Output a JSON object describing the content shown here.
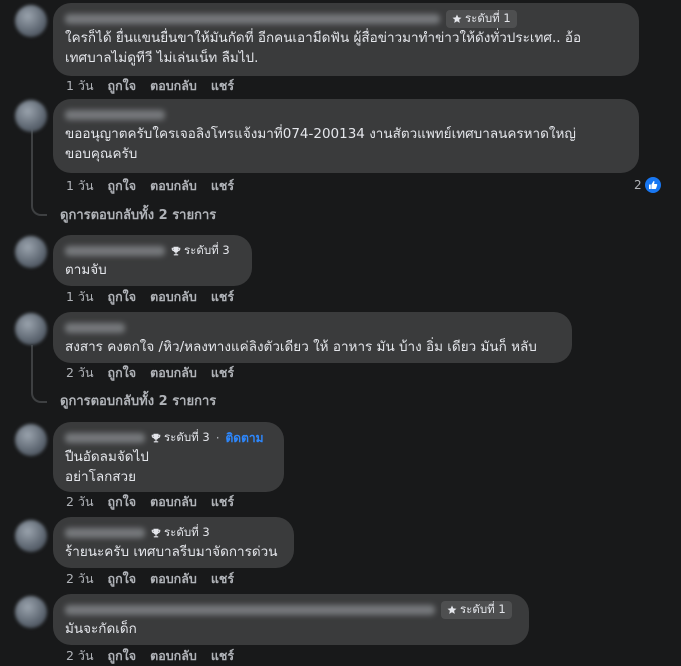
{
  "comments": [
    {
      "badge": "ระดับที่ 1",
      "badge_icon": "star-icon",
      "text": "ใครก็ได้ ยื่นแขนยื่นขาให้มันกัดที่ อีกคนเอามีดฟัน ผู้สื่อข่าวมาทำข่าวให้ดังทั่วประเทศ.. อ้อ\nเทศบาลไม่ดูทีวี ไม่เล่นเน็ท ลืมไป.",
      "age": "1 วัน",
      "like": "ถูกใจ",
      "reply": "ตอบกลับ",
      "share": "แชร์"
    },
    {
      "text": "ขออนุญาตครับใครเจอลิงโทรแจ้งมาที่074-200134 งานสัตวแพทย์เทศบาลนครหาดใหญ่\nขอบคุณครับ",
      "age": "1 วัน",
      "like": "ถูกใจ",
      "reply": "ตอบกลับ",
      "share": "แชร์",
      "reaction_count": "2",
      "view_replies": "ดูการตอบกลับทั้ง 2 รายการ"
    },
    {
      "badge": "ระดับที่ 3",
      "badge_icon": "trophy-icon",
      "text": "ตามจับ",
      "age": "1 วัน",
      "like": "ถูกใจ",
      "reply": "ตอบกลับ",
      "share": "แชร์"
    },
    {
      "text": "สงสาร คงตกใจ /หิว/หลงทางแค่ลิงตัวเดียว ให้ อาหาร มัน บ้าง อิ่ม เดียว มันก็ หลับ",
      "age": "2 วัน",
      "like": "ถูกใจ",
      "reply": "ตอบกลับ",
      "share": "แชร์",
      "view_replies": "ดูการตอบกลับทั้ง 2 รายการ"
    },
    {
      "badge": "ระดับที่ 3",
      "badge_icon": "trophy-icon",
      "dot": "·",
      "follow": "ติดตาม",
      "text": "ปืนอัดลมจัดไป\nอย่าโลกสวย",
      "age": "2 วัน",
      "like": "ถูกใจ",
      "reply": "ตอบกลับ",
      "share": "แชร์"
    },
    {
      "badge": "ระดับที่ 3",
      "badge_icon": "trophy-icon",
      "text": "ร้ายนะครับ เทศบาลรีบมาจัดการด่วน",
      "age": "2 วัน",
      "like": "ถูกใจ",
      "reply": "ตอบกลับ",
      "share": "แชร์"
    },
    {
      "badge": "ระดับที่ 1",
      "badge_icon": "star-icon",
      "text": "มันจะกัดเด็ก",
      "age": "2 วัน",
      "like": "ถูกใจ",
      "reply": "ตอบกลับ",
      "share": "แชร์"
    }
  ],
  "colors": {
    "background": "#18191a",
    "bubble": "#3a3b3c",
    "text": "#e4e6eb",
    "muted": "#b0b3b8",
    "link": "#2d88ff",
    "like": "#1877f2"
  }
}
